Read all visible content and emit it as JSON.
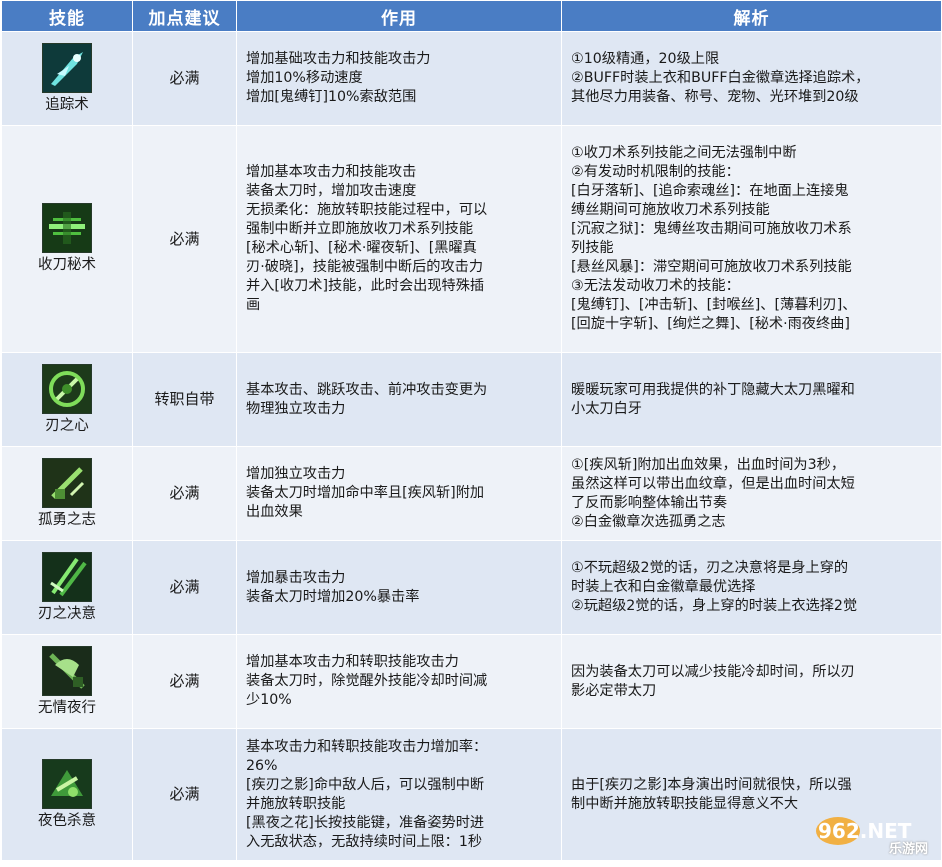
{
  "headers": [
    "技能",
    "加点建议",
    "作用",
    "解析"
  ],
  "rows": [
    {
      "name": "追踪术",
      "icon": "tracking-skill-icon",
      "recommendation": "必满",
      "effect": [
        "增加基础攻击力和技能攻击力",
        "增加10%移动速度",
        "增加[鬼缚钉]10%索敌范围"
      ],
      "analysis": [
        "①10级精通，20级上限",
        "②BUFF时装上衣和BUFF白金徽章选择追踪术，",
        "其他尽力用装备、称号、宠物、光环堆到20级"
      ]
    },
    {
      "name": "收刀秘术",
      "icon": "sheathe-secret-skill-icon",
      "recommendation": "必满",
      "effect": [
        "增加基本攻击力和技能攻击",
        "装备太刀时，增加攻击速度",
        "无损柔化：施放转职技能过程中，可以",
        "强制中断并立即施放收刀术系列技能",
        "[秘术心斩]、[秘术·曜夜斩]、[黑曜真",
        "刃·破晓]，技能被强制中断后的攻击力",
        "并入[收刀术]技能，此时会出现特殊插",
        "画"
      ],
      "analysis": [
        "①收刀术系列技能之间无法强制中断",
        "②有发动时机限制的技能：",
        "[白牙落斩]、[追命索魂丝]：在地面上连接鬼",
        "缚丝期间可施放收刀术系列技能",
        "[沉寂之狱]：鬼缚丝攻击期间可施放收刀术系",
        "列技能",
        "[悬丝风暴]：滞空期间可施放收刀术系列技能",
        "③无法发动收刀术的技能：",
        "[鬼缚钉]、[冲击斩]、[封喉丝]、[薄暮利刃]、",
        "[回旋十字斩]、[绚烂之舞]、[秘术·雨夜终曲]"
      ]
    },
    {
      "name": "刃之心",
      "icon": "blade-heart-skill-icon",
      "recommendation": "转职自带",
      "effect": [
        "基本攻击、跳跃攻击、前冲攻击变更为",
        "物理独立攻击力"
      ],
      "analysis": [
        "暖暖玩家可用我提供的补丁隐藏大太刀黑曜和",
        "小太刀白牙"
      ]
    },
    {
      "name": "孤勇之志",
      "icon": "lone-courage-skill-icon",
      "recommendation": "必满",
      "effect": [
        "增加独立攻击力",
        "装备太刀时增加命中率且[疾风斩]附加",
        "出血效果"
      ],
      "analysis": [
        "①[疾风斩]附加出血效果，出血时间为3秒，",
        "虽然这样可以带出血纹章，但是出血时间太短",
        "了反而影响整体输出节奏",
        "②白金徽章次选孤勇之志"
      ]
    },
    {
      "name": "刃之决意",
      "icon": "blade-resolve-skill-icon",
      "recommendation": "必满",
      "effect": [
        "增加暴击攻击力",
        "装备太刀时增加20%暴击率"
      ],
      "analysis": [
        "①不玩超级2觉的话，刃之决意将是身上穿的",
        "时装上衣和白金徽章最优选择",
        "②玩超级2觉的话，身上穿的时装上衣选择2觉"
      ]
    },
    {
      "name": "无情夜行",
      "icon": "ruthless-night-skill-icon",
      "recommendation": "必满",
      "effect": [
        "增加基本攻击力和转职技能攻击力",
        "装备太刀时，除觉醒外技能冷却时间减",
        "少10%"
      ],
      "analysis": [
        "因为装备太刀可以减少技能冷却时间，所以刃",
        "影必定带太刀"
      ]
    },
    {
      "name": "夜色杀意",
      "icon": "night-killing-intent-skill-icon",
      "recommendation": "必满",
      "effect": [
        "基本攻击力和转职技能攻击力增加率：",
        "26%",
        "[疾刃之影]命中敌人后，可以强制中断",
        "并施放转职技能",
        "[黑夜之花]长按技能键，准备姿势时进",
        "入无敌状态，无敌持续时间上限：1秒"
      ],
      "analysis": [
        "由于[疾刃之影]本身演出时间就很快，所以强",
        "制中断并施放转职技能显得意义不大"
      ]
    }
  ],
  "watermark": {
    "logo": "962.NET",
    "text": "乐游网"
  },
  "colors": {
    "header_bg": "#4a7dc4",
    "row_odd": "#dfe7f3",
    "row_even": "#eef2f8"
  }
}
